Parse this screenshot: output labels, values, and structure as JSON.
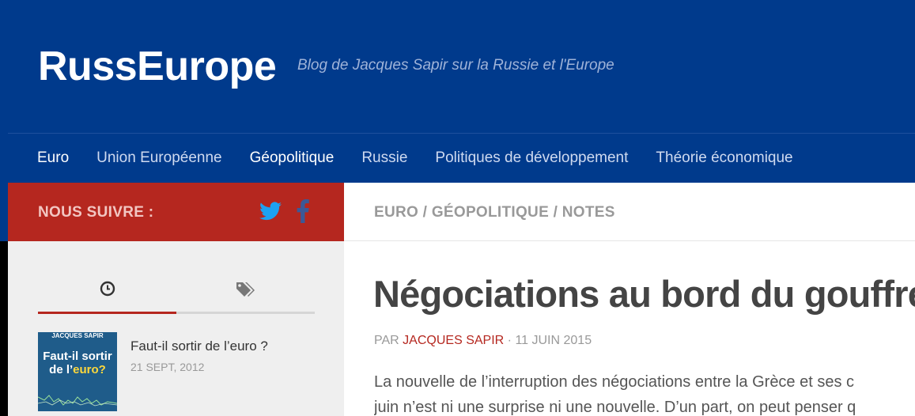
{
  "header": {
    "title": "RussEurope",
    "tagline": "Blog de Jacques Sapir sur la Russie et l'Europe"
  },
  "nav": {
    "items": [
      {
        "label": "Euro",
        "active": true
      },
      {
        "label": "Union Européenne",
        "active": false
      },
      {
        "label": "Géopolitique",
        "active": true
      },
      {
        "label": "Russie",
        "active": false
      },
      {
        "label": "Politiques de développement",
        "active": false
      },
      {
        "label": "Théorie économique",
        "active": false
      }
    ]
  },
  "sidebar": {
    "follow_label": "NOUS SUIVRE :",
    "social": [
      {
        "icon": "twitter-icon",
        "color": "#1da1f2"
      },
      {
        "icon": "facebook-icon",
        "color": "#3b5998"
      }
    ],
    "tabs": [
      {
        "icon": "clock-icon",
        "active": true
      },
      {
        "icon": "tags-icon",
        "active": false
      }
    ],
    "posts": [
      {
        "title": "Faut-il sortir de l’euro ?",
        "date": "21 SEPT, 2012",
        "thumb_author": "JACQUES SAPIR",
        "thumb_title_1": "Faut-il sortir",
        "thumb_title_2": "de l’",
        "thumb_title_hl": "euro?"
      }
    ]
  },
  "article": {
    "breadcrumb": "EURO / GÉOPOLITIQUE / NOTES",
    "title": "Négociations au bord du gouffre",
    "byline_prefix": "PAR",
    "author": "JACQUES SAPIR",
    "byline_sep": "·",
    "date": "11 JUIN 2015",
    "lines": [
      "La nouvelle de l’interruption des négociations entre la Grèce et ses c",
      "juin n’est ni une surprise ni une nouvelle. D’un part, on peut penser q"
    ]
  },
  "colors": {
    "brand_blue": "#003a8c",
    "accent_red": "#b5271f"
  }
}
